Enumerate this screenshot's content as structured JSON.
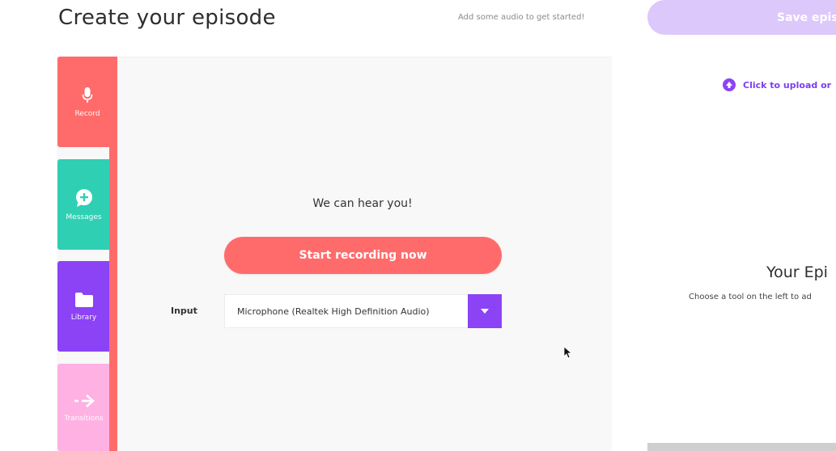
{
  "header": {
    "title": "Create your episode",
    "hint": "Add some audio to get started!",
    "save_label": "Save epis"
  },
  "tabs": [
    {
      "label": "Record",
      "icon": "microphone-icon",
      "color": "#ff6b6b"
    },
    {
      "label": "Messages",
      "icon": "message-plus-icon",
      "color": "#2fcfb3"
    },
    {
      "label": "Library",
      "icon": "folder-icon",
      "color": "#8c43f5"
    },
    {
      "label": "Transitions",
      "icon": "arrow-right-icon",
      "color": "#ffb1e3"
    }
  ],
  "record": {
    "status": "We can hear you!",
    "start_label": "Start recording now",
    "input_label": "Input",
    "input_value": "Microphone (Realtek High Definition Audio)"
  },
  "episode": {
    "upload_label": "Click to upload or",
    "title": "Your Epi",
    "subtitle": "Choose a tool on the left to ad"
  },
  "colors": {
    "accent_red": "#ff6b6b",
    "accent_purple": "#8c43f5",
    "accent_teal": "#2fcfb3",
    "accent_pink": "#ffb1e3"
  }
}
